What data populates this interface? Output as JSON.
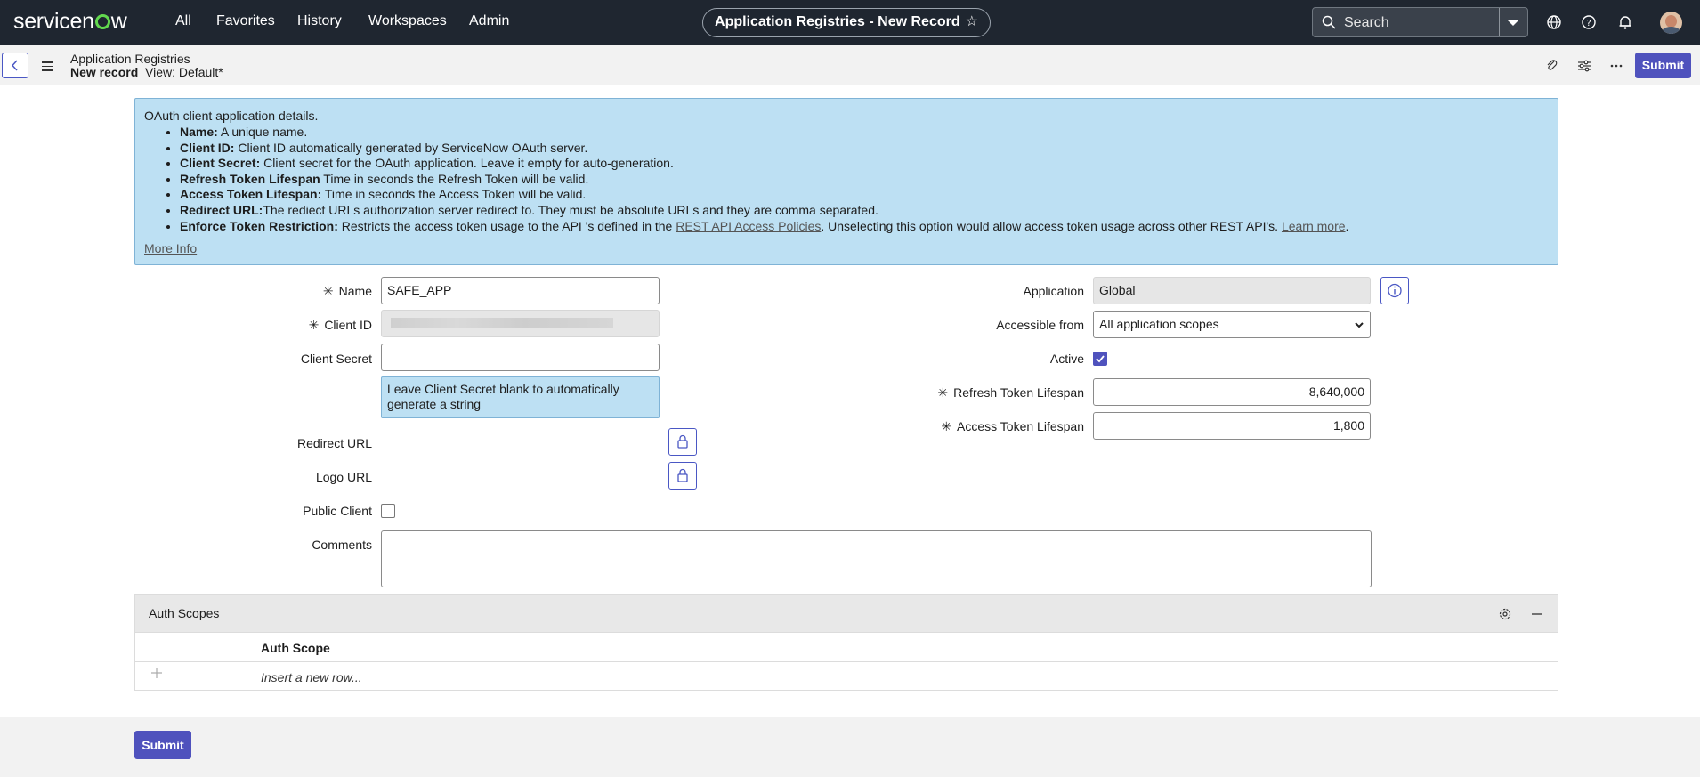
{
  "topnav": {
    "logo_before": "servicen",
    "logo_after": "w",
    "items": [
      "All",
      "Favorites",
      "History",
      "Workspaces",
      "Admin"
    ],
    "record_title": "Application Registries - New Record",
    "search_placeholder": "Search",
    "icons": [
      "globe-icon",
      "help-icon",
      "bell-icon",
      "user-avatar"
    ]
  },
  "header": {
    "breadcrumb_title": "Application Registries",
    "record_label": "New record",
    "view_label": "View: Default*",
    "submit_label": "Submit",
    "icons": [
      "attachment-icon",
      "settings-sliders-icon",
      "more-icon"
    ]
  },
  "info": {
    "intro": "OAuth client application details.",
    "items": [
      {
        "term": "Name:",
        "text": " A unique name."
      },
      {
        "term": "Client ID:",
        "text": " Client ID automatically generated by ServiceNow OAuth server."
      },
      {
        "term": "Client Secret:",
        "text": " Client secret for the OAuth application. Leave it empty for auto-generation."
      },
      {
        "term": "Refresh Token Lifespan",
        "text": " Time in seconds the Refresh Token will be valid."
      },
      {
        "term": "Access Token Lifespan:",
        "text": " Time in seconds the Access Token will be valid."
      },
      {
        "term": "Redirect URL:",
        "text": "The rediect URLs authorization server redirect to. They must be absolute URLs and they are comma separated."
      },
      {
        "term": "Enforce Token Restriction:",
        "text": " Restricts the access token usage to the API 's defined in the ",
        "link1": "REST API Access Policies",
        "text2": ". Unselecting this option would allow access token usage across other REST API's. ",
        "link2": "Learn more",
        "text3": "."
      }
    ],
    "more_info": "More Info"
  },
  "form": {
    "name_label": "Name",
    "name_value": "SAFE_APP",
    "client_id_label": "Client ID",
    "client_secret_label": "Client Secret",
    "client_secret_value": "",
    "client_secret_hint": "Leave Client Secret blank to automatically generate a string",
    "redirect_url_label": "Redirect URL",
    "logo_url_label": "Logo URL",
    "public_client_label": "Public Client",
    "public_client_checked": false,
    "comments_label": "Comments",
    "application_label": "Application",
    "application_value": "Global",
    "accessible_from_label": "Accessible from",
    "accessible_from_value": "All application scopes",
    "active_label": "Active",
    "active_checked": true,
    "refresh_label": "Refresh Token Lifespan",
    "refresh_value": "8,640,000",
    "access_label": "Access Token Lifespan",
    "access_value": "1,800",
    "required_mark": "✳"
  },
  "related": {
    "title": "Auth Scopes",
    "column": "Auth Scope",
    "insert_row": "Insert a new row..."
  },
  "footer": {
    "submit_label": "Submit"
  },
  "colors": {
    "nav_bg": "#1f2630",
    "accent": "#4f52bd",
    "info_bg": "#bde0f3",
    "logo_green": "#62d84e"
  }
}
